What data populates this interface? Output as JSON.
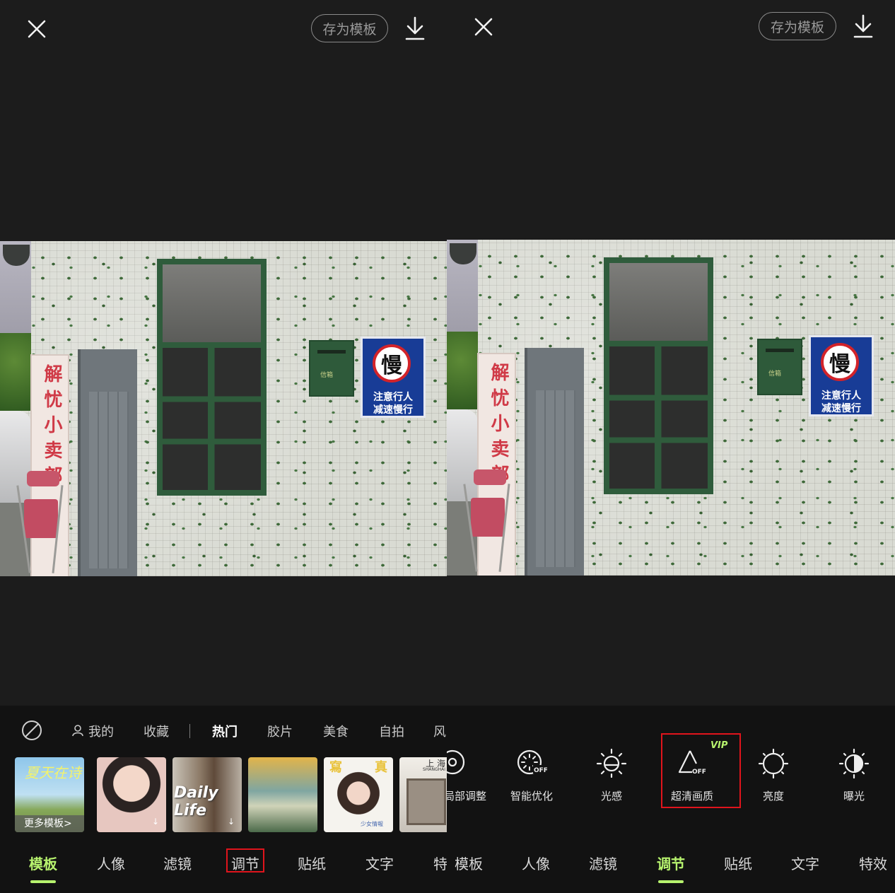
{
  "left": {
    "template_button": "存为模板",
    "categories": [
      "我的",
      "收藏",
      "热门",
      "胶片",
      "美食",
      "自拍",
      "风"
    ],
    "thumb_more_label": "更多模板>",
    "thumb_texts": {
      "t1_script": "夏天在诗",
      "t3_text": "Daily Life",
      "t5_top": "寫",
      "t5_top2": "真",
      "t5_bottom": "少女情報",
      "t6_city": "上 海",
      "t6_city_en": "SHANGHAI"
    },
    "tabs": [
      "模板",
      "人像",
      "滤镜",
      "调节",
      "贴纸",
      "文字",
      "特"
    ],
    "active_tab": "模板",
    "highlighted_tab": "调节"
  },
  "right": {
    "template_button": "存为模板",
    "adjust_items": [
      {
        "label": "局部调整",
        "icon": "local-adjust-icon"
      },
      {
        "label": "智能优化",
        "icon": "smart-optimize-icon"
      },
      {
        "label": "光感",
        "icon": "light-sense-icon"
      },
      {
        "label": "超清画质",
        "icon": "hd-quality-icon",
        "badge": "VIP"
      },
      {
        "label": "亮度",
        "icon": "brightness-icon"
      },
      {
        "label": "曝光",
        "icon": "exposure-icon"
      }
    ],
    "off_badge": "OFF",
    "tabs": [
      "模板",
      "人像",
      "滤镜",
      "调节",
      "贴纸",
      "文字",
      "特效"
    ],
    "active_tab": "调节"
  },
  "photo": {
    "shop_sign": "解忧小卖部",
    "slow_sign_big": "慢",
    "slow_sign_line1": "注意行人",
    "slow_sign_line2": "减速慢行",
    "mailbox_label": "信箱"
  },
  "colors": {
    "accent": "#b7f36e",
    "highlight_box": "#e0141c",
    "background": "#1c1c1c",
    "bottom_panel": "#121212",
    "vip": "#b7f36e"
  }
}
